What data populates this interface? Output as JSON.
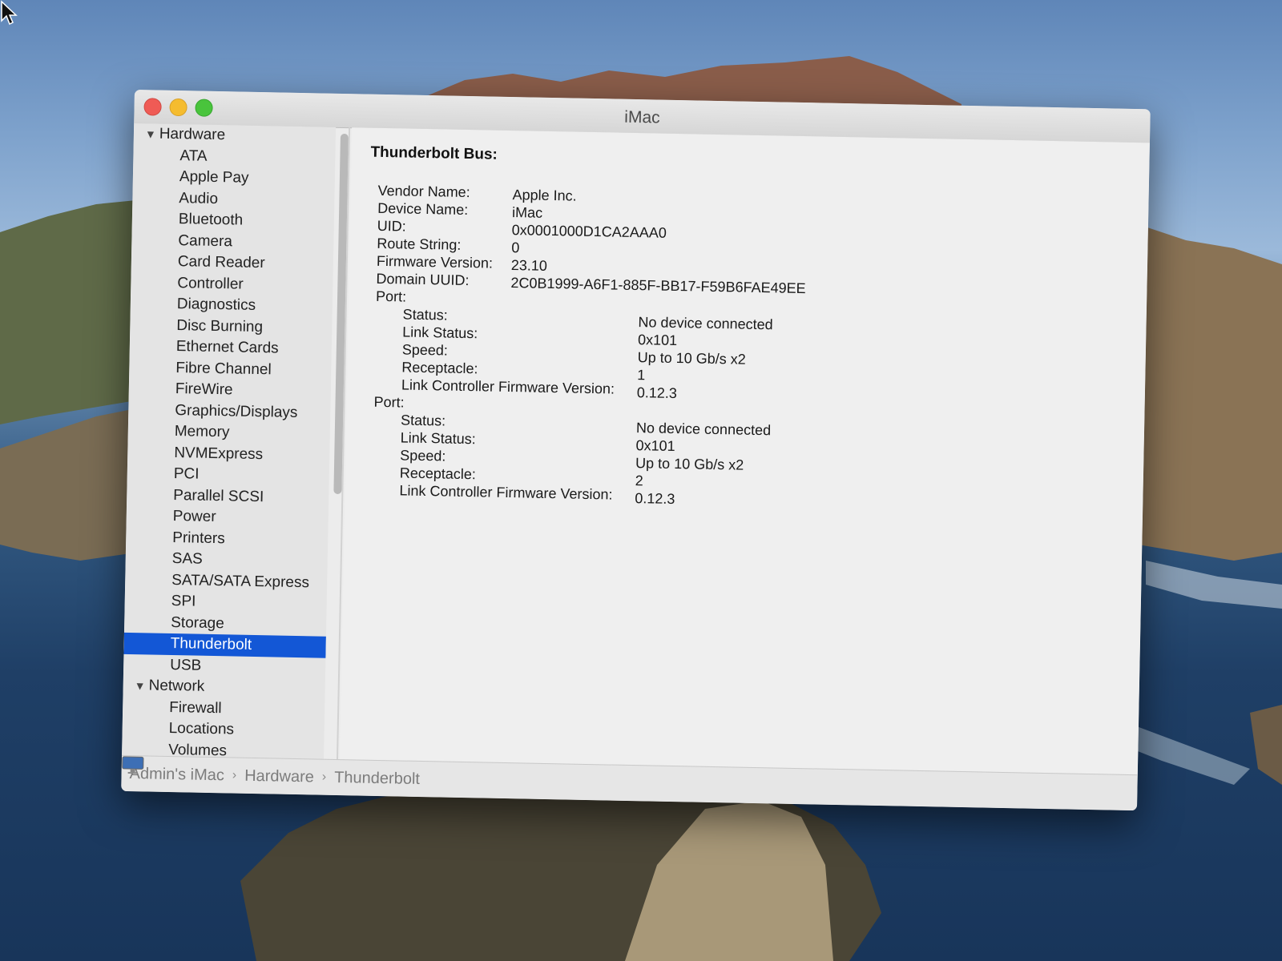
{
  "window": {
    "title": "iMac"
  },
  "sidebar": {
    "sections": [
      {
        "label": "Hardware",
        "items": [
          "ATA",
          "Apple Pay",
          "Audio",
          "Bluetooth",
          "Camera",
          "Card Reader",
          "Controller",
          "Diagnostics",
          "Disc Burning",
          "Ethernet Cards",
          "Fibre Channel",
          "FireWire",
          "Graphics/Displays",
          "Memory",
          "NVMExpress",
          "PCI",
          "Parallel SCSI",
          "Power",
          "Printers",
          "SAS",
          "SATA/SATA Express",
          "SPI",
          "Storage",
          "Thunderbolt",
          "USB"
        ]
      },
      {
        "label": "Network",
        "items": [
          "Firewall",
          "Locations",
          "Volumes"
        ]
      }
    ],
    "selected": "Thunderbolt"
  },
  "detail": {
    "heading": "Thunderbolt Bus:",
    "bus": {
      "vendor_label": "Vendor Name:",
      "vendor_value": "Apple Inc.",
      "device_label": "Device Name:",
      "device_value": "iMac",
      "uid_label": "UID:",
      "uid_value": "0x0001000D1CA2AAA0",
      "route_label": "Route String:",
      "route_value": "0",
      "firmware_label": "Firmware Version:",
      "firmware_value": "23.10",
      "domain_label": "Domain UUID:",
      "domain_value": "2C0B1999-A6F1-885F-BB17-F59B6FAE49EE"
    },
    "ports": [
      {
        "label": "Port:",
        "status_label": "Status:",
        "status_value": "No device connected",
        "link_status_label": "Link Status:",
        "link_status_value": "0x101",
        "speed_label": "Speed:",
        "speed_value": "Up to 10 Gb/s x2",
        "receptacle_label": "Receptacle:",
        "receptacle_value": "1",
        "lc_fw_label": "Link Controller Firmware Version:",
        "lc_fw_value": "0.12.3"
      },
      {
        "label": "Port:",
        "status_label": "Status:",
        "status_value": "No device connected",
        "link_status_label": "Link Status:",
        "link_status_value": "0x101",
        "speed_label": "Speed:",
        "speed_value": "Up to 10 Gb/s x2",
        "receptacle_label": "Receptacle:",
        "receptacle_value": "2",
        "lc_fw_label": "Link Controller Firmware Version:",
        "lc_fw_value": "0.12.3"
      }
    ]
  },
  "statusbar": {
    "path": [
      "Admin's iMac",
      "Hardware",
      "Thunderbolt"
    ]
  },
  "colors": {
    "selection": "#1357d6",
    "close": "#ef5b55",
    "minimize": "#f5bc2f",
    "zoom": "#49c43c"
  }
}
